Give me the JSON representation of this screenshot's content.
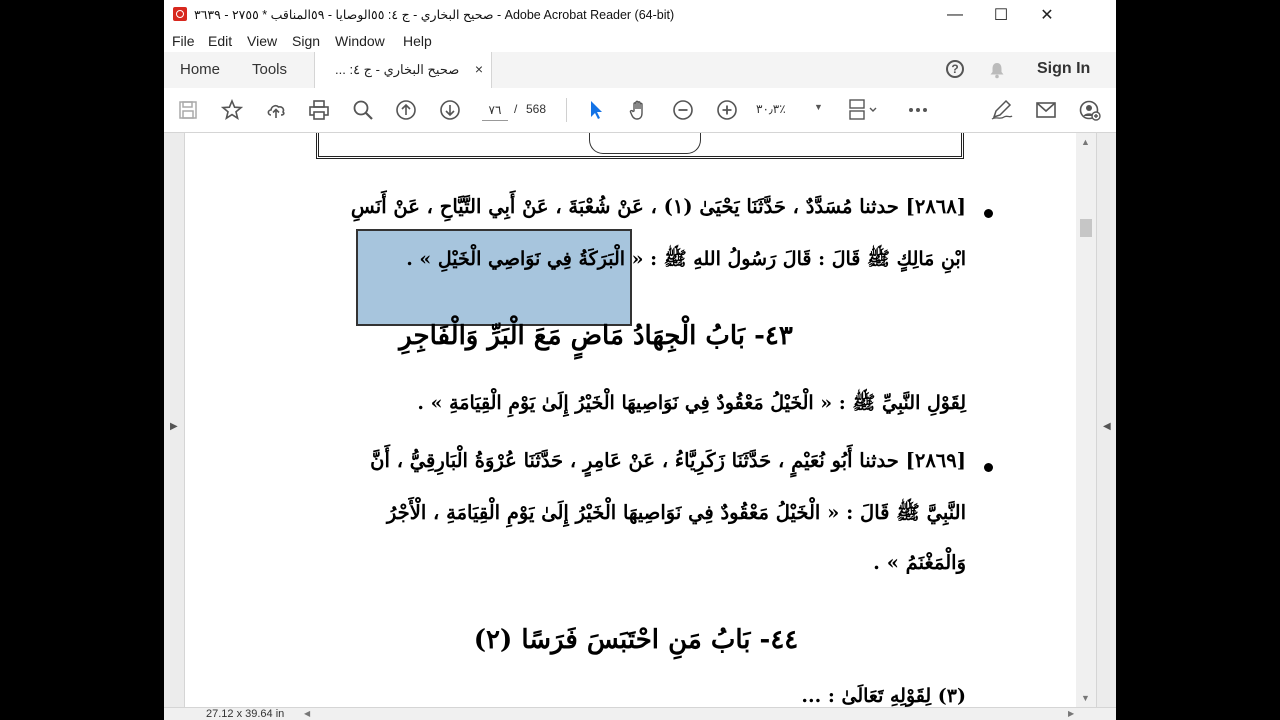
{
  "window": {
    "title": "صحيح البخاري - ج ٤: ٥٥الوصايا - ٥٩المناقب * ٢٧٥٥ - ٣٦٣٩ - Adobe Acrobat Reader (64-bit)"
  },
  "menu": [
    "File",
    "Edit",
    "View",
    "Sign",
    "Window",
    "Help"
  ],
  "tabs": {
    "home": "Home",
    "tools": "Tools",
    "document": "صحيح البخاري - ج ٤: ...",
    "close": "×"
  },
  "header_right": {
    "sign_in": "Sign In",
    "help": "?"
  },
  "toolbar": {
    "page_current": "٧٦",
    "page_sep": "/",
    "page_total": "568",
    "zoom": "٣٠٫٣٪"
  },
  "document": {
    "hadith1_line1": "[٢٨٦٨] حدثنا مُسَدَّدٌ ، حَدَّثَنَا يَحْيَىٰ (١) ، عَنْ شُعْبَةَ ، عَنْ أَبِي التَّيَّاحِ ، عَنْ أَنَسِ",
    "hadith1_line2": "ابْنِ مَالِكٍ ﷺ قَالَ : قَالَ رَسُولُ اللهِ ﷺ : « الْبَرَكَةُ فِي نَوَاصِي الْخَيْلِ » .",
    "chapter43_title": "٤٣- بَابُ الْجِهَادُ مَاضٍ مَعَ الْبَرِّ وَالْفَاجِرِ",
    "chapter43_text": "لِقَوْلِ النَّبِيِّ ﷺ : « الْخَيْلُ مَعْقُودٌ فِي نَوَاصِيهَا الْخَيْرُ إِلَىٰ يَوْمِ الْقِيَامَةِ » .",
    "hadith2_line1": "[٢٨٦٩] حدثنا أَبُو نُعَيْمٍ ، حَدَّثَنَا زَكَرِيَّاءُ ، عَنْ عَامِرٍ ، حَدَّثَنَا عُرْوَةُ الْبَارِقِيُّ ، أَنَّ",
    "hadith2_line2": "النَّبِيَّ ﷺ قَالَ : « الْخَيْلُ مَعْقُودٌ فِي نَوَاصِيهَا الْخَيْرُ إِلَىٰ يَوْمِ الْقِيَامَةِ ، الْأَجْرُ",
    "hadith2_line3": "وَالْمَغْنَمُ » .",
    "chapter44_title": "٤٤- بَابُ مَنِ احْتَبَسَ فَرَسًا (٢)",
    "partial_line": "(٣) لِقَوْلِهِ تَعَالَىٰ : ..."
  },
  "status": {
    "dimensions": "27.12 x 39.64 in"
  },
  "colors": {
    "highlight": "#a7c5dd",
    "acrobat_red": "#d7281e",
    "select_arrow": "#1473e6"
  }
}
